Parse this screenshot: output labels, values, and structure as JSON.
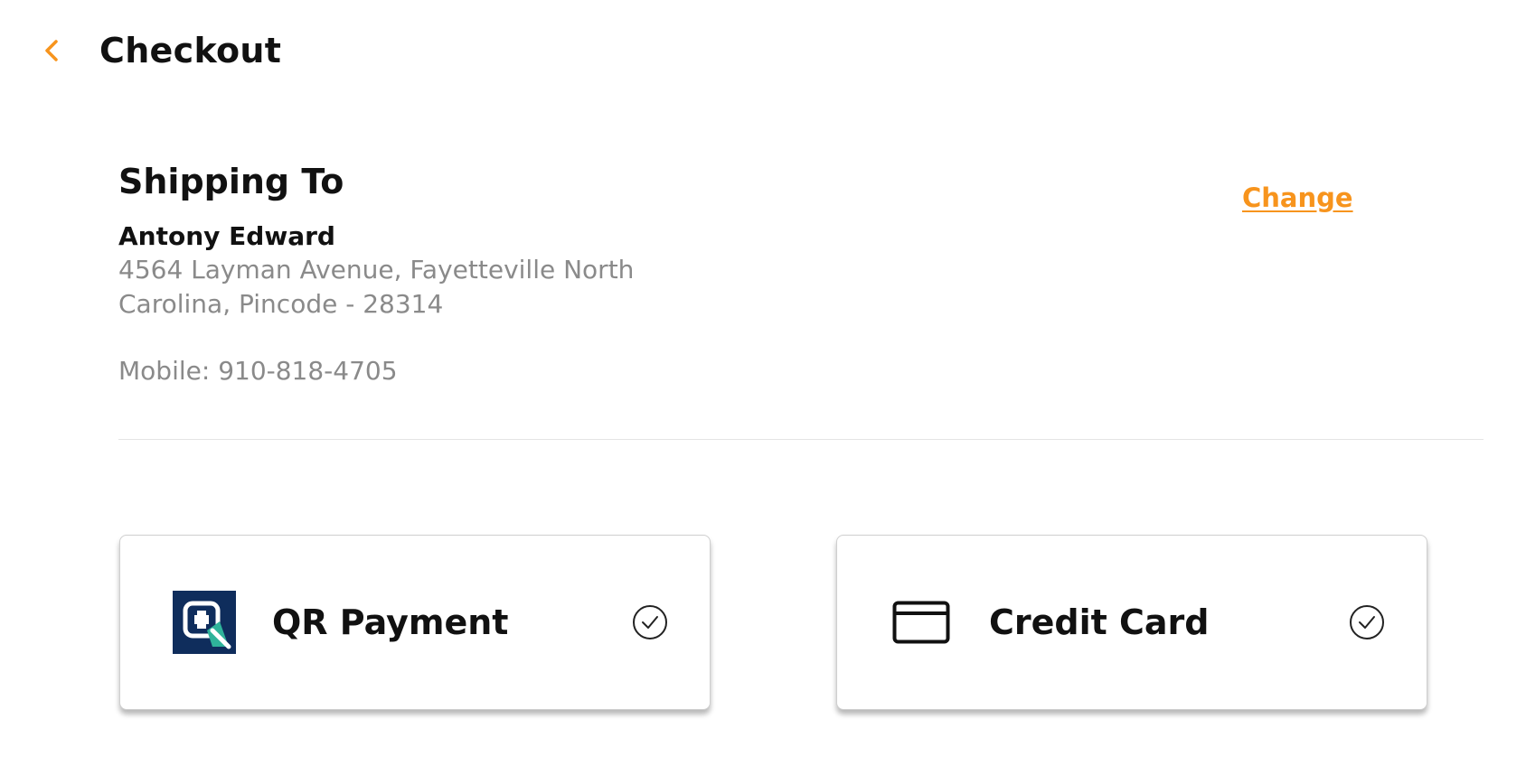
{
  "header": {
    "title": "Checkout",
    "back_icon": "chevron-left-icon"
  },
  "shipping": {
    "heading": "Shipping To",
    "change_label": "Change",
    "name": "Antony Edward",
    "address_line1": "4564 Layman Avenue, Fayetteville North",
    "address_line2": "Carolina, Pincode - 28314",
    "mobile_label": "Mobile:",
    "mobile_number": "910-818-4705"
  },
  "payment_methods": [
    {
      "label": "QR Payment",
      "icon": "qr-payment-icon",
      "check_icon": "check-circle-icon"
    },
    {
      "label": "Credit Card",
      "icon": "credit-card-icon",
      "check_icon": "check-circle-icon"
    }
  ],
  "colors": {
    "accent": "#f7941d",
    "text_primary": "#111111",
    "text_secondary": "#8a8a8a",
    "qr_icon_bg": "#0f2d5c",
    "qr_icon_accent": "#2fb39a"
  }
}
